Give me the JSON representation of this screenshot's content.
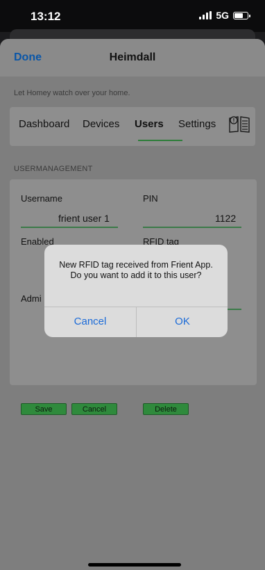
{
  "status": {
    "time": "13:12",
    "network": "5G"
  },
  "nav": {
    "done": "Done",
    "title": "Heimdall"
  },
  "tagline": "Let Homey watch over your home.",
  "tabs": [
    {
      "label": "Dashboard",
      "active": false
    },
    {
      "label": "Devices",
      "active": false
    },
    {
      "label": "Users",
      "active": true
    },
    {
      "label": "Settings",
      "active": false
    }
  ],
  "section_title": "USERMANAGEMENT",
  "form": {
    "username_label": "Username",
    "username_value": "frient user 1",
    "pin_label": "PIN",
    "pin_value": "1122",
    "enabled_label": "Enabled",
    "rfid_label": "RFID tag",
    "admin_label": "Admi",
    "save": "Save",
    "cancel": "Cancel",
    "delete": "Delete"
  },
  "dialog": {
    "message": "New RFID tag received from Frient App. Do you want to add it to this user?",
    "cancel": "Cancel",
    "ok": "OK"
  },
  "colors": {
    "accent_green": "#2e7d3a",
    "link_blue": "#1a6ad8"
  }
}
